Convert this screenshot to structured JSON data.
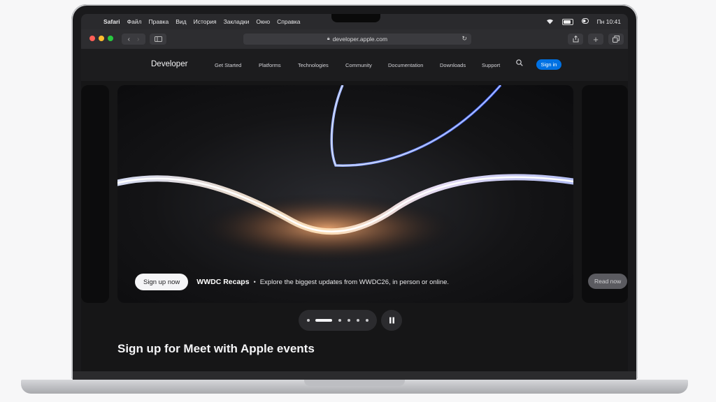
{
  "menubar": {
    "app": "Safari",
    "items": [
      "Файл",
      "Правка",
      "Вид",
      "История",
      "Закладки",
      "Окно",
      "Справка"
    ],
    "clock": "Пн 10:41"
  },
  "browser": {
    "url": "developer.apple.com"
  },
  "nav": {
    "logo": "Developer",
    "links": [
      "Get Started",
      "Platforms",
      "Technologies",
      "Community",
      "Documentation",
      "Downloads",
      "Support"
    ],
    "signin": "Sign in"
  },
  "hero": {
    "cta": "Sign up now",
    "title": "WWDC Recaps",
    "separator": "•",
    "description": "Explore the biggest updates from WWDC26, in person or online.",
    "next_cta": "Read now"
  },
  "carousel": {
    "slides": 6,
    "active_index": 1
  },
  "section": {
    "title": "Sign up for Meet with Apple events"
  },
  "colors": {
    "accent": "#0071e3",
    "background": "#161617"
  }
}
